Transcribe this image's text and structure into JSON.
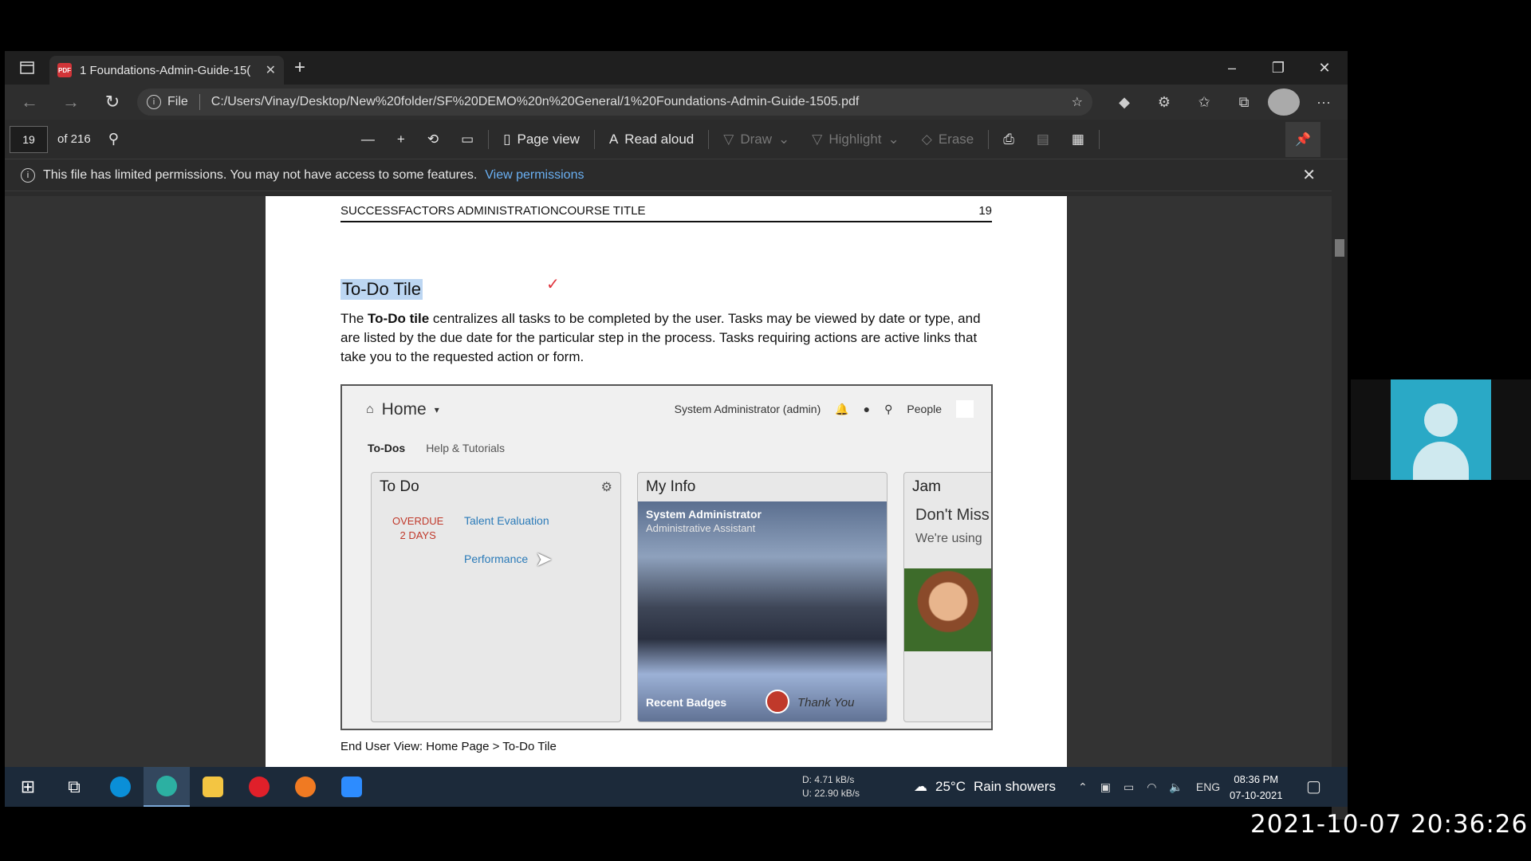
{
  "browser": {
    "tab_title": "1 Foundations-Admin-Guide-15(",
    "new_tab": "+",
    "file_label": "File",
    "url": "C:/Users/Vinay/Desktop/New%20folder/SF%20DEMO%20n%20General/1%20Foundations-Admin-Guide-1505.pdf"
  },
  "pdf_toolbar": {
    "page_number": "19",
    "page_total": "of 216",
    "page_view": "Page view",
    "read_aloud": "Read aloud",
    "draw": "Draw",
    "highlight": "Highlight",
    "erase": "Erase"
  },
  "banner": {
    "message": "This file has limited permissions. You may not have access to some features.",
    "link": "View permissions"
  },
  "page": {
    "header_left": "SUCCESSFACTORS ADMINISTRATIONCOURSE TITLE",
    "header_right": "19",
    "section_title": "To-Do Tile",
    "body_pre": "The ",
    "body_bold": "To-Do tile",
    "body_post": " centralizes all tasks to be completed by the user. Tasks may be viewed by date or type, and are listed by the due date for the particular step in the process. Tasks requiring actions are active links that take you to the requested action or form.",
    "caption": "End User View:  Home Page > To-Do Tile"
  },
  "figure": {
    "home": "Home",
    "user": "System Administrator (admin)",
    "people": "People",
    "tabs": [
      "To-Dos",
      "Help & Tutorials"
    ],
    "todo_title": "To Do",
    "overdue_1": "OVERDUE",
    "overdue_2": "2 DAYS",
    "link_1": "Talent Evaluation",
    "link_2": "Performance",
    "myinfo_title": "My Info",
    "myinfo_name": "System Administrator",
    "myinfo_role": "Administrative Assistant",
    "recent_badges": "Recent Badges",
    "thank_you": "Thank You",
    "jam_title": "Jam",
    "jam_line1": "Don't Miss",
    "jam_line2": "We're using"
  },
  "taskbar": {
    "net_down": "D:    4.71 kB/s",
    "net_up": "U:   22.90 kB/s",
    "temperature": "25°C",
    "weather": "Rain showers",
    "lang": "ENG",
    "time": "08:36 PM",
    "date": "07-10-2021"
  },
  "timestamp": "2021-10-07 20:36:26",
  "colors": {
    "accent_link": "#6ab0f3",
    "overdue": "#c0392b",
    "highlight": "#bcd6f2"
  }
}
